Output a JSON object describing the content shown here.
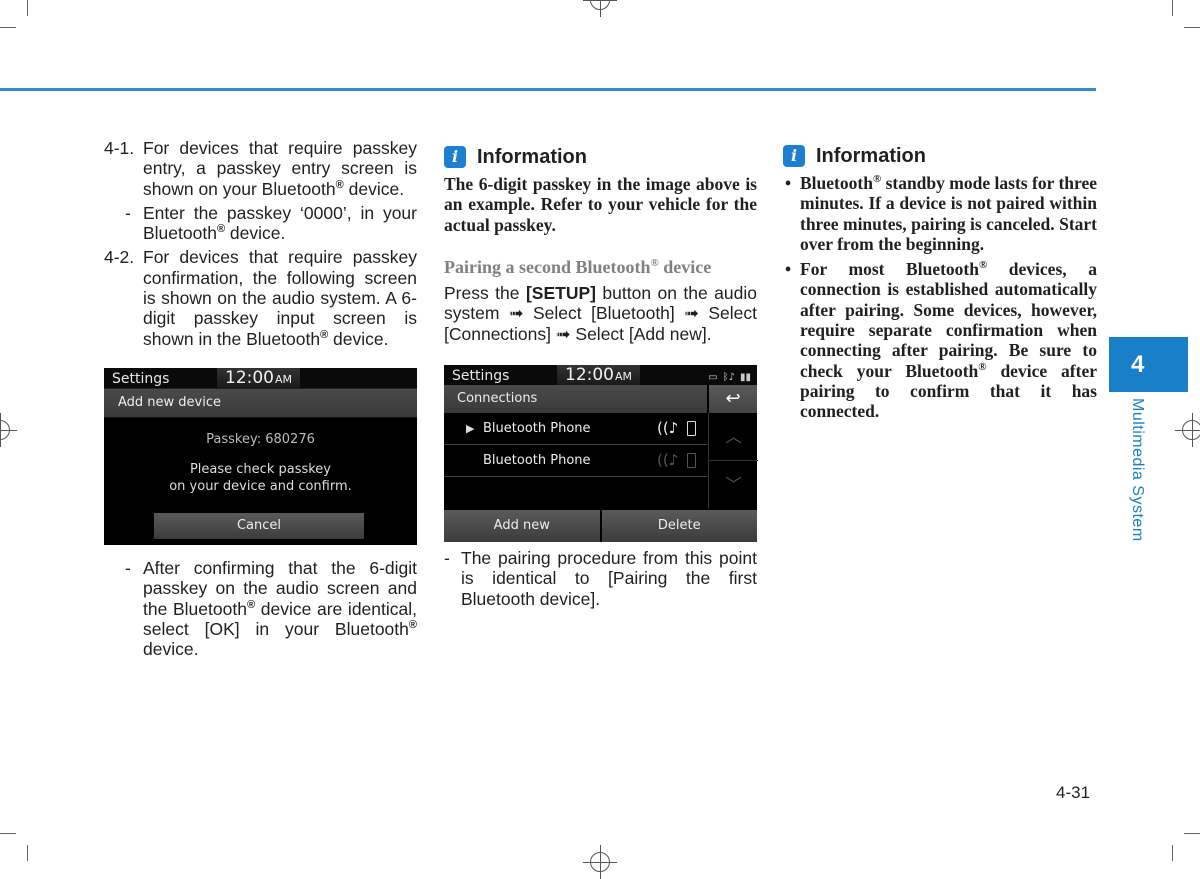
{
  "page": {
    "accent_color": "#1a7fc9",
    "chapter_number": "4",
    "chapter_title": "Multimedia System",
    "page_number": "4-31"
  },
  "column1": {
    "step_4_1": {
      "num": "4-1.",
      "text_a": "For devices that require passkey entry, a passkey entry screen is shown on your Bluetooth",
      "text_b": " device."
    },
    "sub_4_1": {
      "dash": "-",
      "text_a": "Enter the passkey ‘0000’, in your Bluetooth",
      "text_b": " device."
    },
    "step_4_2": {
      "num": "4-2.",
      "text_a": "For devices that require passkey confirmation, the following screen is shown on the audio system. A 6-digit passkey input screen is shown in the Bluetooth",
      "text_b": " device."
    },
    "screen1": {
      "title": "Settings",
      "clock": "12:00",
      "ampm": "AM",
      "bar_label": "Add new device",
      "passkey": "Passkey: 680276",
      "message_line1": "Please check passkey",
      "message_line2": "on your device and confirm.",
      "cancel_label": "Cancel"
    },
    "sub_after": {
      "dash": "-",
      "text_a": "After confirming that the 6-digit passkey on the audio screen and the Bluetooth",
      "text_b": " device are identical, select [OK] in your Bluetooth",
      "text_c": " device."
    },
    "reg": "®"
  },
  "column2": {
    "info_icon": "i",
    "info_title": "Information",
    "info_text": "The 6-digit passkey in the image above is an example. Refer to your vehicle for the actual passkey.",
    "section_title_a": "Pairing a second Bluetooth",
    "section_title_b": " device",
    "para_a": "Press the ",
    "para_bold": "[SETUP]",
    "para_b": " button on the audio system ➟ Select [Bluetooth] ➟ Select [Connections] ➟ Select [Add new].",
    "screen2": {
      "title": "Settings",
      "clock": "12:00",
      "ampm": "AM",
      "status_icons": [
        "battery-icon",
        "bluetooth-audio-icon",
        "signal-icon"
      ],
      "status_glyphs": [
        "▭",
        "ᛒ♪",
        "▮▮"
      ],
      "bar_label": "Connections",
      "back_glyph": "↩",
      "devices": [
        {
          "name": "Bluetooth Phone",
          "selected": true,
          "active": true
        },
        {
          "name": "Bluetooth Phone",
          "selected": false,
          "active": false
        }
      ],
      "arrow_glyph": "▶",
      "audio_glyph": "((♪",
      "scroll_up_glyph": "︿",
      "scroll_down_glyph": "﹀",
      "add_new_label": "Add new",
      "delete_label": "Delete"
    },
    "sub_note": {
      "dash": "-",
      "text": "The pairing procedure from this point is identical to [Pairing the first Bluetooth device]."
    }
  },
  "column3": {
    "info_icon": "i",
    "info_title": "Information",
    "bullet_glyph": "•",
    "bullet1_a": "Bluetooth",
    "bullet1_b": " standby mode lasts for three minutes. If a device is not paired within three minutes, pairing is canceled. Start over from the beginning.",
    "bullet2_a": "For most Bluetooth",
    "bullet2_b": " devices, a connection is established automatically after pairing. Some devices, however, require separate confirmation when connecting after pairing. Be sure to check your Bluetooth",
    "bullet2_c": " device after pairing to confirm that it has connected."
  }
}
